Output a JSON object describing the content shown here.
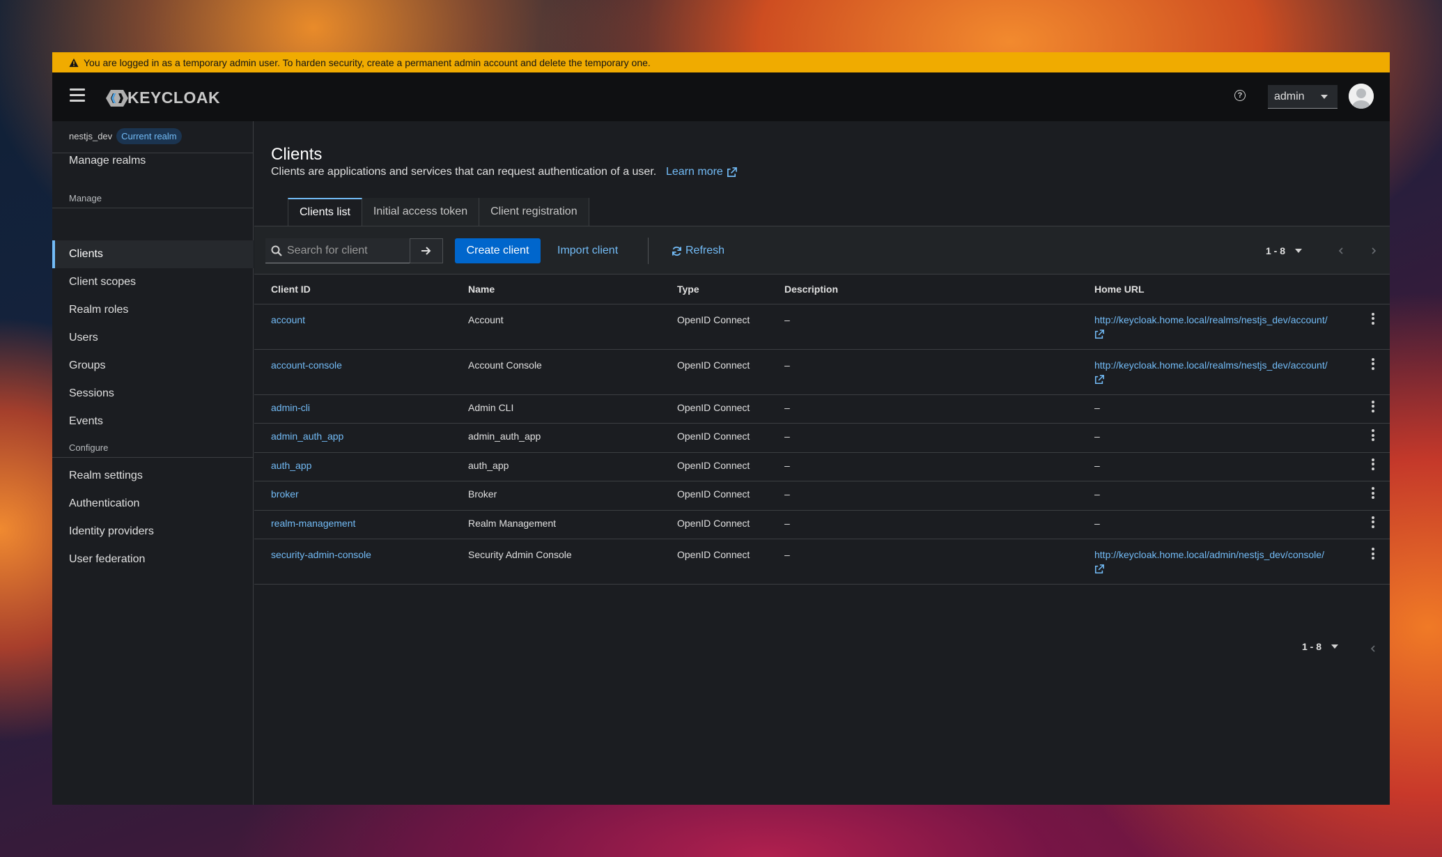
{
  "banner": {
    "text": "You are logged in as a temporary admin user. To harden security, create a permanent admin account and delete the temporary one."
  },
  "header": {
    "logo_text": "KEYCLOAK",
    "user_label": "admin"
  },
  "sidebar": {
    "realm_name": "nestjs_dev",
    "realm_badge": "Current realm",
    "manage_realms": "Manage realms",
    "manage_section": "Manage",
    "manage_items": [
      "Clients",
      "Client scopes",
      "Realm roles",
      "Users",
      "Groups",
      "Sessions",
      "Events"
    ],
    "configure_section": "Configure",
    "configure_items": [
      "Realm settings",
      "Authentication",
      "Identity providers",
      "User federation"
    ],
    "active_item": "Clients"
  },
  "page": {
    "title": "Clients",
    "description": "Clients are applications and services that can request authentication of a user.",
    "learn_more": "Learn more"
  },
  "tabs": [
    "Clients list",
    "Initial access token",
    "Client registration"
  ],
  "toolbar": {
    "search_placeholder": "Search for client",
    "create_label": "Create client",
    "import_label": "Import client",
    "refresh_label": "Refresh",
    "pagination": "1 - 8"
  },
  "table": {
    "headers": [
      "Client ID",
      "Name",
      "Type",
      "Description",
      "Home URL"
    ],
    "rows": [
      {
        "client_id": "account",
        "name": "Account",
        "type": "OpenID Connect",
        "description": "–",
        "home_url": "http://keycloak.home.local/realms/nestjs_dev/account/"
      },
      {
        "client_id": "account-console",
        "name": "Account Console",
        "type": "OpenID Connect",
        "description": "–",
        "home_url": "http://keycloak.home.local/realms/nestjs_dev/account/"
      },
      {
        "client_id": "admin-cli",
        "name": "Admin CLI",
        "type": "OpenID Connect",
        "description": "–",
        "home_url": "–"
      },
      {
        "client_id": "admin_auth_app",
        "name": "admin_auth_app",
        "type": "OpenID Connect",
        "description": "–",
        "home_url": "–"
      },
      {
        "client_id": "auth_app",
        "name": "auth_app",
        "type": "OpenID Connect",
        "description": "–",
        "home_url": "–"
      },
      {
        "client_id": "broker",
        "name": "Broker",
        "type": "OpenID Connect",
        "description": "–",
        "home_url": "–"
      },
      {
        "client_id": "realm-management",
        "name": "Realm Management",
        "type": "OpenID Connect",
        "description": "–",
        "home_url": "–"
      },
      {
        "client_id": "security-admin-console",
        "name": "Security Admin Console",
        "type": "OpenID Connect",
        "description": "–",
        "home_url": "http://keycloak.home.local/admin/nestjs_dev/console/"
      }
    ]
  },
  "footer": {
    "pagination": "1 - 8"
  },
  "colors": {
    "accent": "#73bcf7",
    "primary_button": "#0066cc",
    "banner": "#f0ab00",
    "background": "#1b1d21"
  }
}
